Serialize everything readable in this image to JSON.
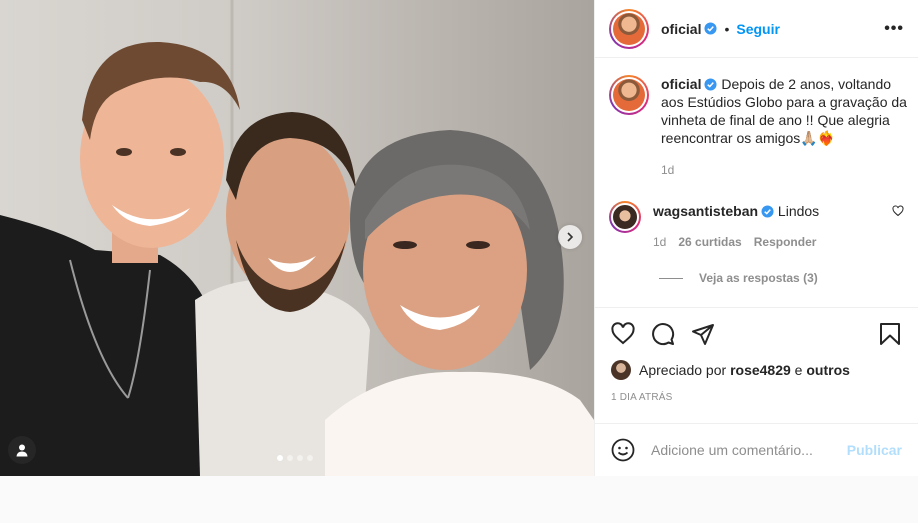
{
  "post": {
    "author": "oficial",
    "follow_label": "Seguir",
    "separator": "•",
    "more_label": "•••",
    "caption": "Depois de 2 anos, voltando aos Estúdios Globo para a gravação da vinheta de final de ano !! Que alegria reencontrar os amigos🙏🏼❤️‍🔥",
    "caption_time": "1d",
    "carousel": {
      "slides": 4,
      "active_index": 0
    }
  },
  "comment": {
    "author": "wagsantisteban",
    "text": "Lindos",
    "time": "1d",
    "likes": "26 curtidas",
    "reply_label": "Responder",
    "view_replies": "Veja as respostas (3)"
  },
  "likes": {
    "prefix": "Apreciado por",
    "user": "rose4829",
    "connector": "e",
    "others": "outros"
  },
  "timestamp": "1 DIA ATRÁS",
  "add_comment": {
    "placeholder": "Adicione um comentário...",
    "publish_label": "Publicar"
  },
  "colors": {
    "accent_blue": "#0095f6",
    "verified_blue": "#3897f0",
    "muted": "#8e8e8e",
    "text": "#262626"
  },
  "icons": [
    "verified-icon",
    "more-icon",
    "heart-icon",
    "comment-icon",
    "share-icon",
    "bookmark-icon",
    "emoji-icon",
    "chevron-right-icon",
    "user-tag-icon"
  ]
}
